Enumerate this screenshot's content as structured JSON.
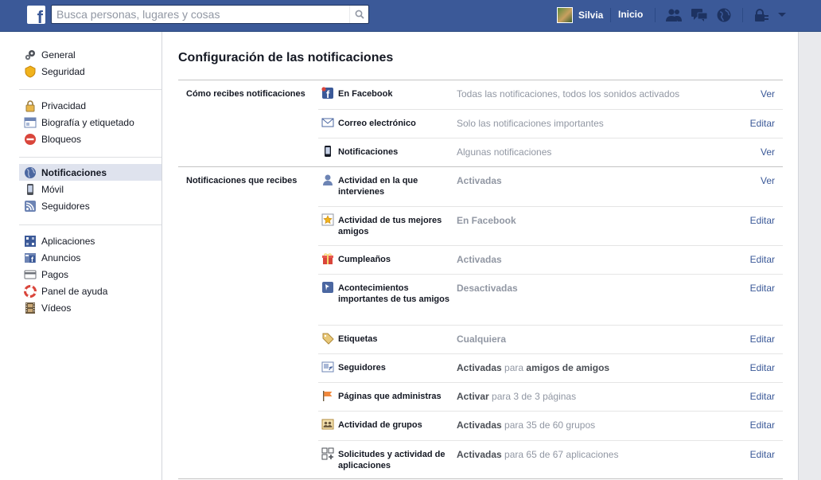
{
  "topbar": {
    "logo_letter": "f",
    "search_placeholder": "Busca personas, lugares y cosas",
    "user_name": "Silvia",
    "home_label": "Inicio",
    "icons": [
      "friend-requests-icon",
      "messages-icon",
      "notifications-globe-icon",
      "privacy-lock-icon",
      "account-menu-chevron-icon"
    ],
    "bg_color": "#3b5998"
  },
  "sidebar": {
    "groups": [
      [
        {
          "label": "General",
          "icon": "gears-icon"
        },
        {
          "label": "Seguridad",
          "icon": "shield-badge-icon"
        }
      ],
      [
        {
          "label": "Privacidad",
          "icon": "privacy-lock-icon"
        },
        {
          "label": "Biografía y etiquetado",
          "icon": "timeline-icon"
        },
        {
          "label": "Bloqueos",
          "icon": "block-icon"
        }
      ],
      [
        {
          "label": "Notificaciones",
          "icon": "globe-icon",
          "active": true
        },
        {
          "label": "Móvil",
          "icon": "mobile-icon"
        },
        {
          "label": "Seguidores",
          "icon": "rss-icon"
        }
      ],
      [
        {
          "label": "Aplicaciones",
          "icon": "apps-icon"
        },
        {
          "label": "Anuncios",
          "icon": "ads-icon"
        },
        {
          "label": "Pagos",
          "icon": "credit-card-icon"
        },
        {
          "label": "Panel de ayuda",
          "icon": "lifebuoy-icon"
        },
        {
          "label": "Vídeos",
          "icon": "film-icon"
        }
      ]
    ]
  },
  "main": {
    "title": "Configuración de las notificaciones",
    "sections": [
      {
        "label": "Cómo recibes notificaciones",
        "rows": [
          {
            "name": "En Facebook",
            "value": "Todas las notificaciones, todos los sonidos activados",
            "action": "Ver",
            "icon": "facebook-notification-icon"
          },
          {
            "name": "Correo electrónico",
            "value": "Solo las notificaciones importantes",
            "action": "Editar",
            "icon": "envelope-icon"
          },
          {
            "name": "Notificaciones",
            "value": "Algunas notificaciones",
            "action": "Ver",
            "icon": "phone-icon"
          }
        ]
      },
      {
        "label": "Notificaciones que recibes",
        "rows": [
          {
            "name": "Actividad en la que intervienes",
            "value": "Activadas",
            "action": "Ver",
            "icon": "person-icon"
          },
          {
            "name": "Actividad de tus mejores amigos",
            "value": "En Facebook",
            "action": "Editar",
            "icon": "star-friend-icon"
          },
          {
            "name": "Cumpleaños",
            "value": "Activadas",
            "action": "Editar",
            "icon": "gift-icon"
          },
          {
            "name": "Acontecimientos importantes de tus amigos",
            "value": "Desactivadas",
            "action": "Editar",
            "icon": "life-event-flag-icon"
          },
          {
            "name": "Etiquetas",
            "value": "Cualquiera",
            "action": "Editar",
            "icon": "tag-icon"
          },
          {
            "name": "Seguidores",
            "value_strong": "Activadas",
            "value_mid": " para ",
            "value_tail": "amigos de amigos",
            "action": "Editar",
            "icon": "followers-icon"
          },
          {
            "name": "Páginas que administras",
            "value_strong": "Activar",
            "value_mid": " para 3 de 3 páginas",
            "value_tail": "",
            "action": "Editar",
            "icon": "pages-flag-icon"
          },
          {
            "name": "Actividad de grupos",
            "value_strong": "Activadas",
            "value_mid": " para 35 de 60 grupos",
            "value_tail": "",
            "action": "Editar",
            "icon": "groups-icon"
          },
          {
            "name": "Solicitudes y actividad de aplicaciones",
            "value_strong": "Activadas",
            "value_mid": " para 65 de 67 aplicaciones",
            "value_tail": "",
            "action": "Editar",
            "icon": "apps-requests-icon"
          }
        ]
      }
    ]
  }
}
